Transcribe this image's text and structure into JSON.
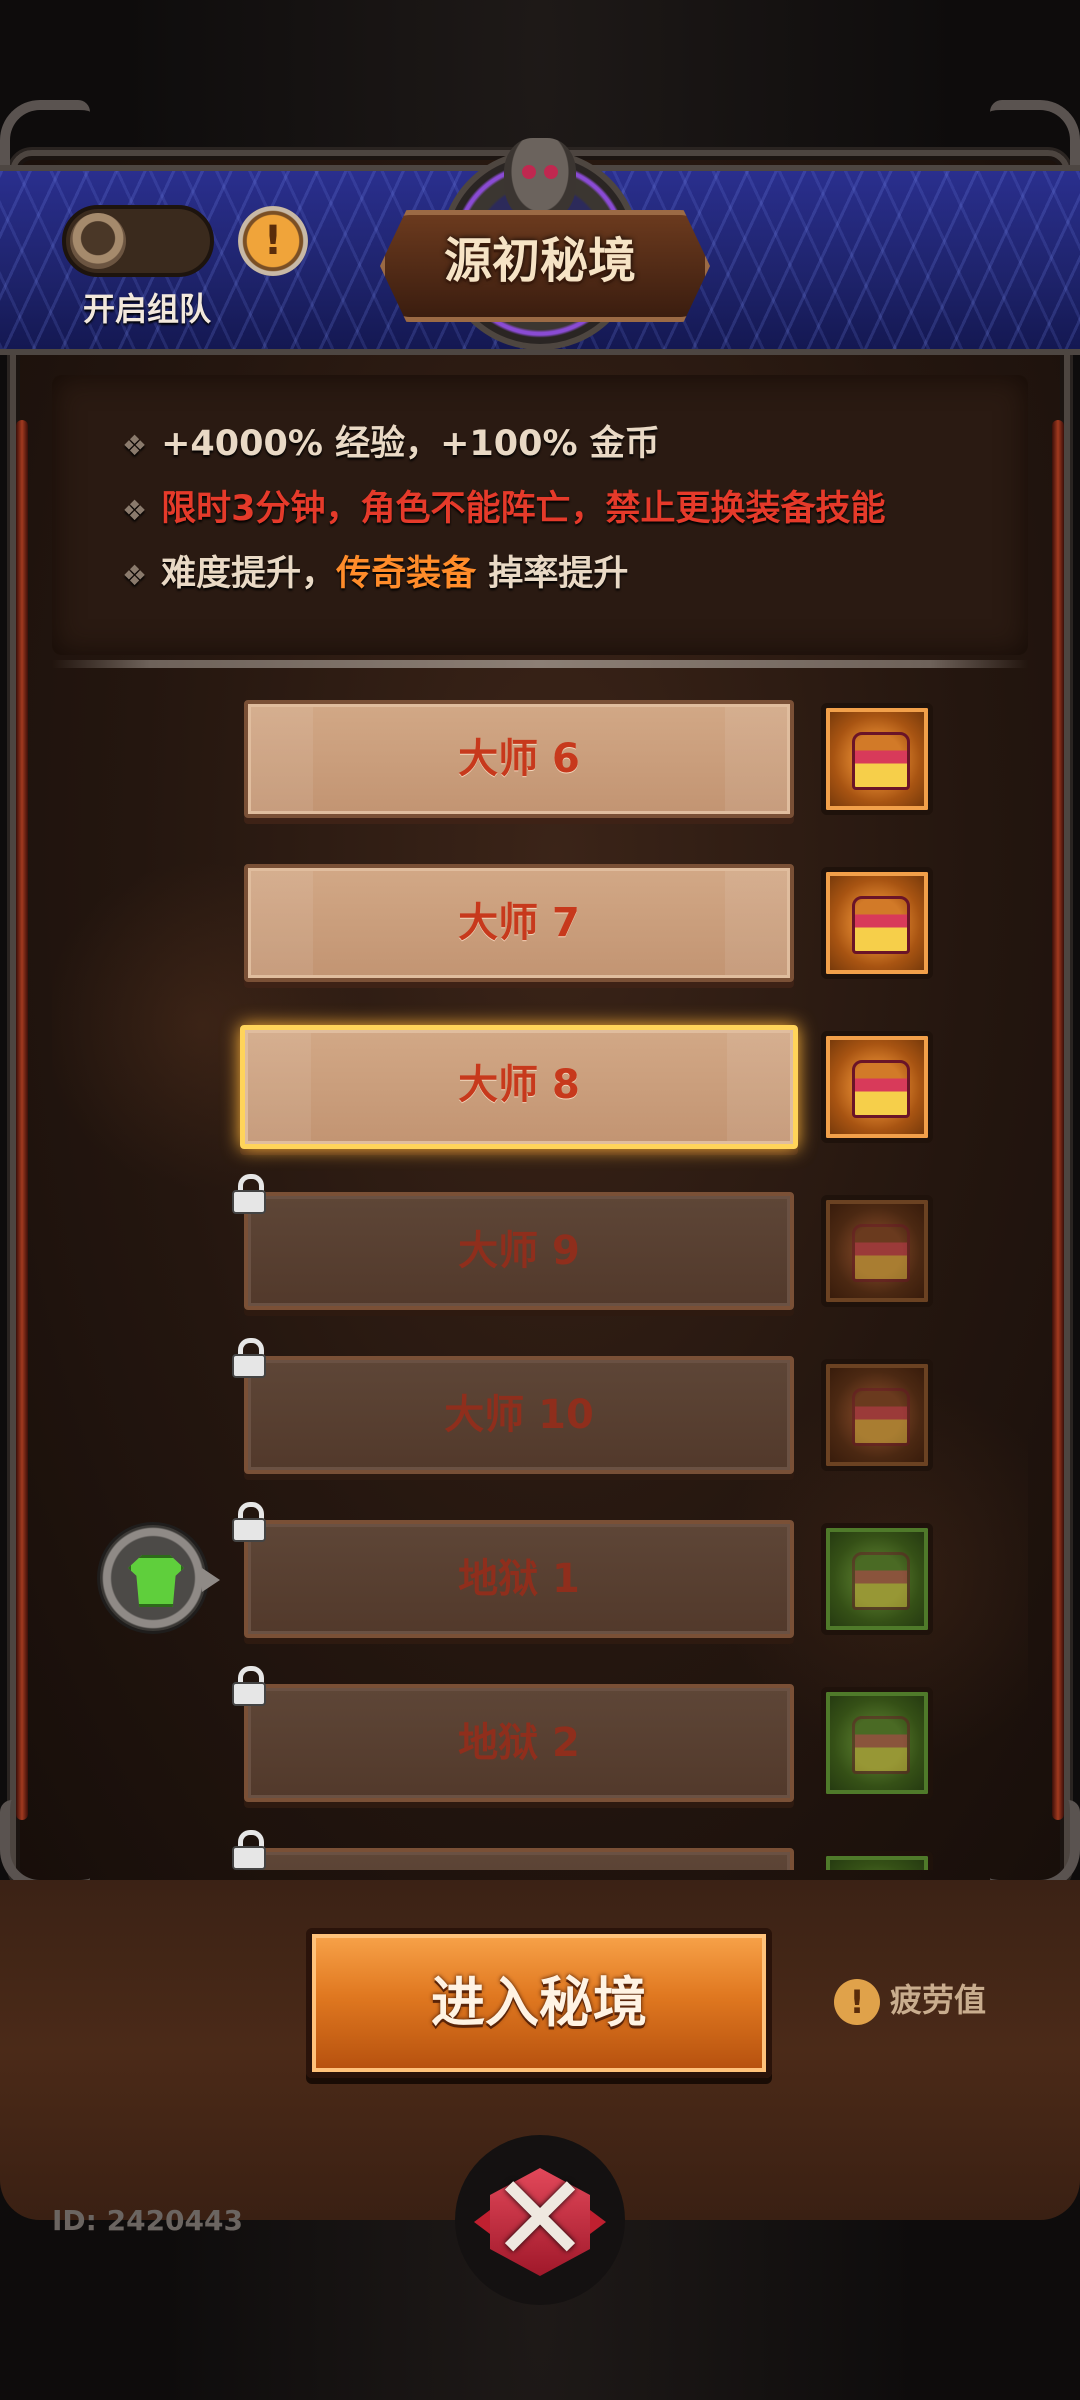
{
  "header": {
    "toggle_label": "开启组队",
    "info_icon": "!",
    "title": "源初秘境"
  },
  "info": {
    "line1": "+4000% 经验，+100% 金币",
    "line2": "限时3分钟，角色不能阵亡，禁止更换装备技能",
    "line3_prefix": "难度提升，",
    "line3_highlight": "传奇装备",
    "line3_suffix": " 掉率提升",
    "bullet": "❖"
  },
  "levels": [
    {
      "label": "大师 6",
      "locked": false,
      "selected": false,
      "chest": "gold"
    },
    {
      "label": "大师 7",
      "locked": false,
      "selected": false,
      "chest": "gold"
    },
    {
      "label": "大师 8",
      "locked": false,
      "selected": true,
      "chest": "gold"
    },
    {
      "label": "大师 9",
      "locked": true,
      "selected": false,
      "chest": "dim"
    },
    {
      "label": "大师 10",
      "locked": true,
      "selected": false,
      "chest": "dim"
    },
    {
      "label": "地狱 1",
      "locked": true,
      "selected": false,
      "chest": "green"
    },
    {
      "label": "地狱 2",
      "locked": true,
      "selected": false,
      "chest": "green"
    },
    {
      "label": "",
      "locked": true,
      "selected": false,
      "chest": "green"
    }
  ],
  "footer": {
    "enter_label": "进入秘境",
    "fatigue_label": "疲劳值",
    "fatigue_icon": "!",
    "close_icon": "✕",
    "user_id": "ID: 2420443"
  },
  "colors": {
    "accent_orange": "#e07820",
    "warning_red": "#e53a2a",
    "legend_orange": "#ff8c2a",
    "selected_border": "#ffd45a"
  }
}
